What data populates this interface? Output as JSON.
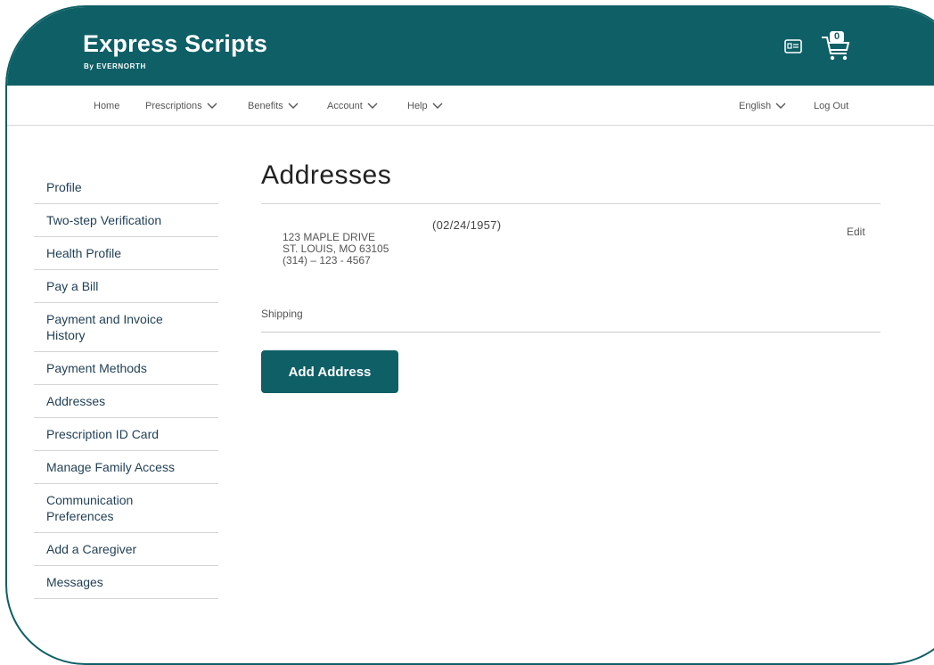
{
  "brand": {
    "name": "Express Scripts",
    "tagline": "By EVERNORTH",
    "primary_color": "#0e5f66"
  },
  "header": {
    "id_card_icon": "id-card-icon",
    "cart_icon": "cart-icon",
    "cart_count": "0"
  },
  "nav": {
    "items": [
      {
        "label": "Home"
      },
      {
        "label": "Prescriptions"
      },
      {
        "label": "Benefits"
      },
      {
        "label": "Account"
      },
      {
        "label": "Help"
      }
    ],
    "language": "English",
    "logout": "Log Out"
  },
  "sidebar": {
    "items": [
      {
        "label": "Profile"
      },
      {
        "label": "Two-step Verification"
      },
      {
        "label": "Health Profile"
      },
      {
        "label": "Pay a Bill"
      },
      {
        "label": "Payment and Invoice History"
      },
      {
        "label": "Payment Methods"
      },
      {
        "label": "Addresses"
      },
      {
        "label": "Prescription ID Card"
      },
      {
        "label": "Manage Family Access"
      },
      {
        "label": "Communication Preferences"
      },
      {
        "label": "Add a Caregiver"
      },
      {
        "label": "Messages"
      }
    ]
  },
  "main": {
    "title": "Addresses",
    "address": {
      "line1": "123 MAPLE DRIVE",
      "line2": "ST. LOUIS, MO 63105",
      "phone": "(314) – 123 - 4567",
      "dob": "(02/24/1957)",
      "edit_label": "Edit"
    },
    "section_label": "Shipping",
    "add_button": "Add Address"
  }
}
